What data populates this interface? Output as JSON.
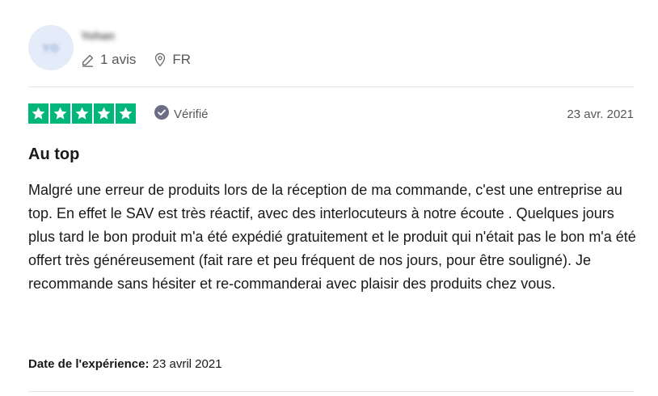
{
  "reviewer": {
    "initials": "YO",
    "name": "Yohan",
    "reviews_count": "1 avis",
    "country": "FR"
  },
  "rating": {
    "stars": 5,
    "max": 5,
    "star_color": "#00b67a"
  },
  "verified_label": "Vérifié",
  "date": "23 avr. 2021",
  "title": "Au top",
  "body": "Malgré une erreur de produits lors de la réception de ma commande, c'est une entreprise au top. En effet le SAV est très réactif, avec des interlocuteurs à notre écoute . Quelques jours plus tard le bon produit m'a été expédié gratuitement et le produit qui n'était pas le bon m'a été offert très généreusement (fait rare et peu fréquent de nos jours, pour être souligné). Je recommande sans hésiter et re-commanderai avec plaisir des produits chez vous.",
  "experience": {
    "label": "Date de l'expérience:",
    "value": "23 avril 2021"
  },
  "icons": {
    "reviews": "pencil-icon",
    "country": "location-pin-icon",
    "verified": "check-circle-icon",
    "star": "star-icon"
  }
}
